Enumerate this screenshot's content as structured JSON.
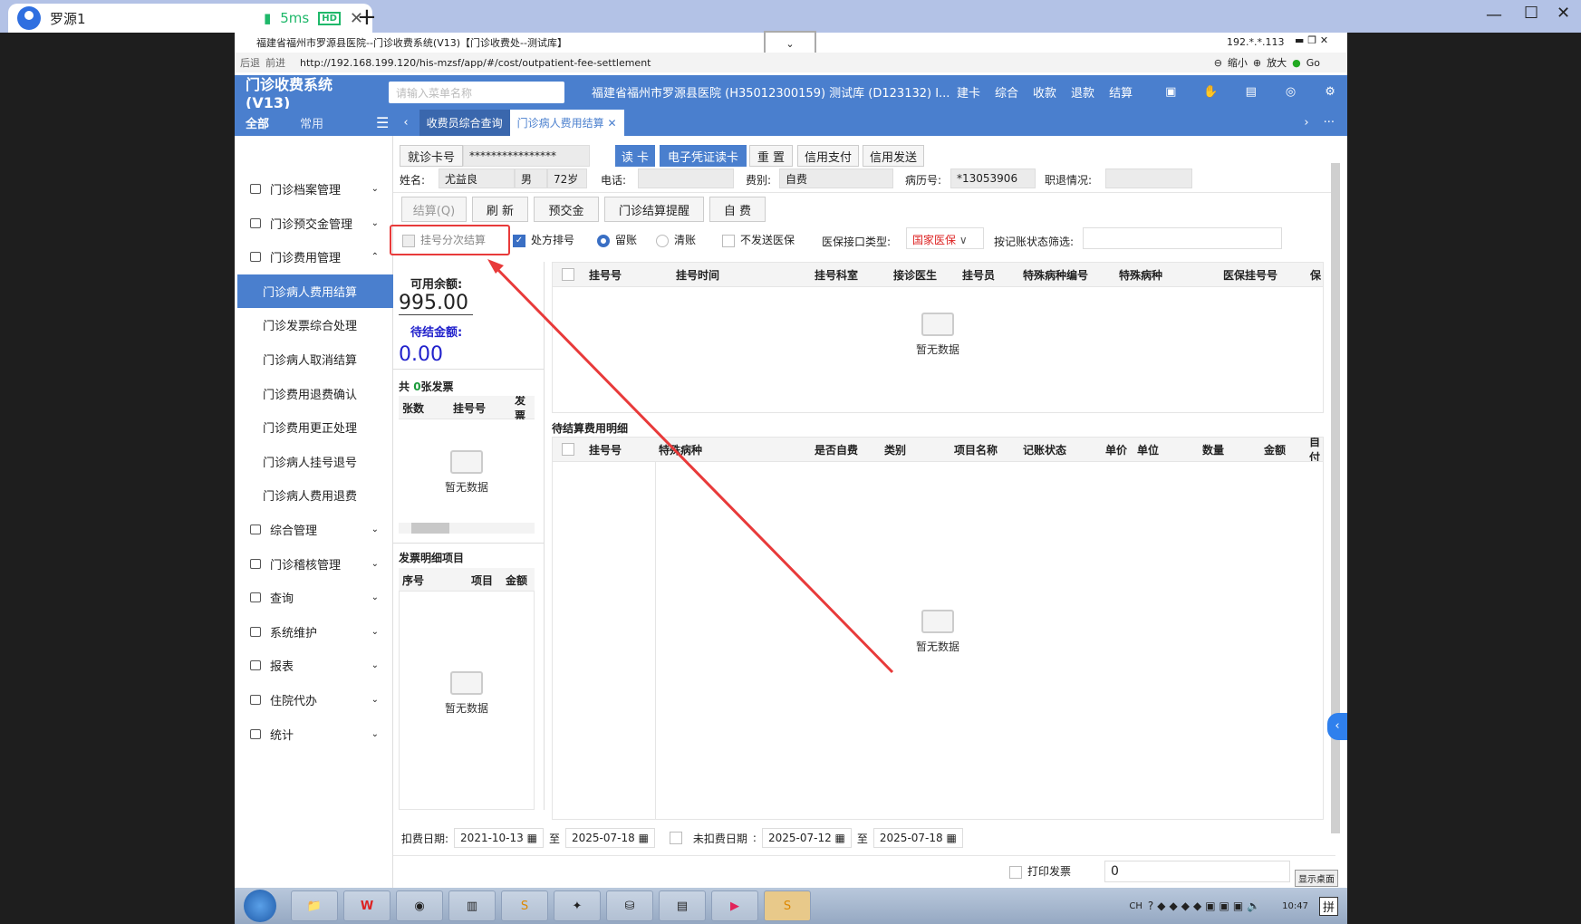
{
  "browser": {
    "tab_title": "罗源1",
    "latency": "5ms",
    "hd": "HD",
    "close": "✕",
    "new_tab": "+"
  },
  "window": {
    "title": "福建省福州市罗源县医院--门诊收费系统(V13)【门诊收费处--测试库】",
    "ip": "192.*.*.113",
    "back": "后退",
    "forward": "前进",
    "url": "http://192.168.199.120/his-mzsf/app/#/cost/outpatient-fee-settlement",
    "zoom_out": "缩小",
    "zoom_in": "放大",
    "go": "Go"
  },
  "header": {
    "app_name": "门诊收费系统(V13)",
    "search_placeholder": "请输入菜单名称",
    "hospital": "福建省福州市罗源县医院 (H35012300159) 测试库 (D123132) I...",
    "nav": [
      "建卡",
      "综合",
      "收款",
      "退款",
      "结算"
    ]
  },
  "tabs": {
    "all": "全部",
    "common": "常用",
    "items": [
      "收费员综合查询",
      "门诊病人费用结算"
    ]
  },
  "sidebar": [
    {
      "label": "门诊档案管理"
    },
    {
      "label": "门诊预交金管理"
    },
    {
      "label": "门诊费用管理",
      "open": true
    },
    {
      "label": "门诊病人费用结算",
      "sub": true,
      "active": true
    },
    {
      "label": "门诊发票综合处理",
      "sub": true
    },
    {
      "label": "门诊病人取消结算",
      "sub": true
    },
    {
      "label": "门诊费用退费确认",
      "sub": true
    },
    {
      "label": "门诊费用更正处理",
      "sub": true
    },
    {
      "label": "门诊病人挂号退号",
      "sub": true
    },
    {
      "label": "门诊病人费用退费",
      "sub": true
    },
    {
      "label": "综合管理"
    },
    {
      "label": "门诊稽核管理"
    },
    {
      "label": "查询"
    },
    {
      "label": "系统维护"
    },
    {
      "label": "报表"
    },
    {
      "label": "住院代办"
    },
    {
      "label": "统计"
    }
  ],
  "patient": {
    "card_label": "就诊卡号",
    "card_value": "****************",
    "read_card": "读 卡",
    "e_card": "电子凭证读卡",
    "reset": "重 置",
    "credit_pay": "信用支付",
    "credit_send": "信用发送",
    "name_label": "姓名:",
    "name": "尤益良",
    "sex": "男",
    "age": "72岁",
    "phone_label": "电话:",
    "phone": "",
    "fee_type_label": "费别:",
    "fee_type": "自费",
    "record_label": "病历号:",
    "record": "*13053906",
    "retire_label": "职退情况:",
    "retire": ""
  },
  "actions": {
    "settle": "结算(Q)",
    "refresh": "刷 新",
    "prepay": "预交金",
    "remind": "门诊结算提醒",
    "self_pay": "自 费"
  },
  "options": {
    "split": "挂号分次结算",
    "rx_sort": "处方排号",
    "keep": "留账",
    "clear": "清账",
    "no_send": "不发送医保",
    "iface_label": "医保接口类型:",
    "iface_value": "国家医保",
    "filter_label": "按记账状态筛选:"
  },
  "balance": {
    "avail_label": "可用余额:",
    "avail": "995.00",
    "pending_label": "待结金额:",
    "pending": "0.00"
  },
  "invoices": {
    "prefix": "共 ",
    "count": "0",
    "suffix": "张发票",
    "cols": [
      "张数",
      "挂号号",
      "发票"
    ],
    "empty": "暂无数据"
  },
  "invoice_items": {
    "title": "发票明细项目",
    "cols": [
      "序号",
      "项目",
      "金额"
    ],
    "empty": "暂无数据"
  },
  "reg_table": {
    "cols": [
      "挂号号",
      "挂号时间",
      "挂号科室",
      "接诊医生",
      "挂号员",
      "特殊病种编号",
      "特殊病种",
      "医保挂号号",
      "保"
    ],
    "empty": "暂无数据"
  },
  "detail": {
    "title": "待结算费用明细",
    "cols": [
      "挂号号",
      "特殊病种",
      "是否自费",
      "类别",
      "项目名称",
      "记账状态",
      "单价",
      "单位",
      "数量",
      "金额",
      "自付"
    ],
    "empty": "暂无数据"
  },
  "dates": {
    "deduct_label": "扣费日期:",
    "from": "2021-10-13",
    "to_label": "至",
    "to": "2025-07-18",
    "undeduct_label": "未扣费日期",
    "from2": "2025-07-12",
    "to2": "2025-07-18"
  },
  "print": {
    "label": "打印发票",
    "value": "0"
  },
  "taskbar": {
    "show_desktop": "显示桌面",
    "lang": "CH",
    "time": "10:47",
    "ime": "拼"
  },
  "colors": {
    "primary": "#4a7fce",
    "annotation": "#e83a3a",
    "pending": "#2222cc"
  }
}
